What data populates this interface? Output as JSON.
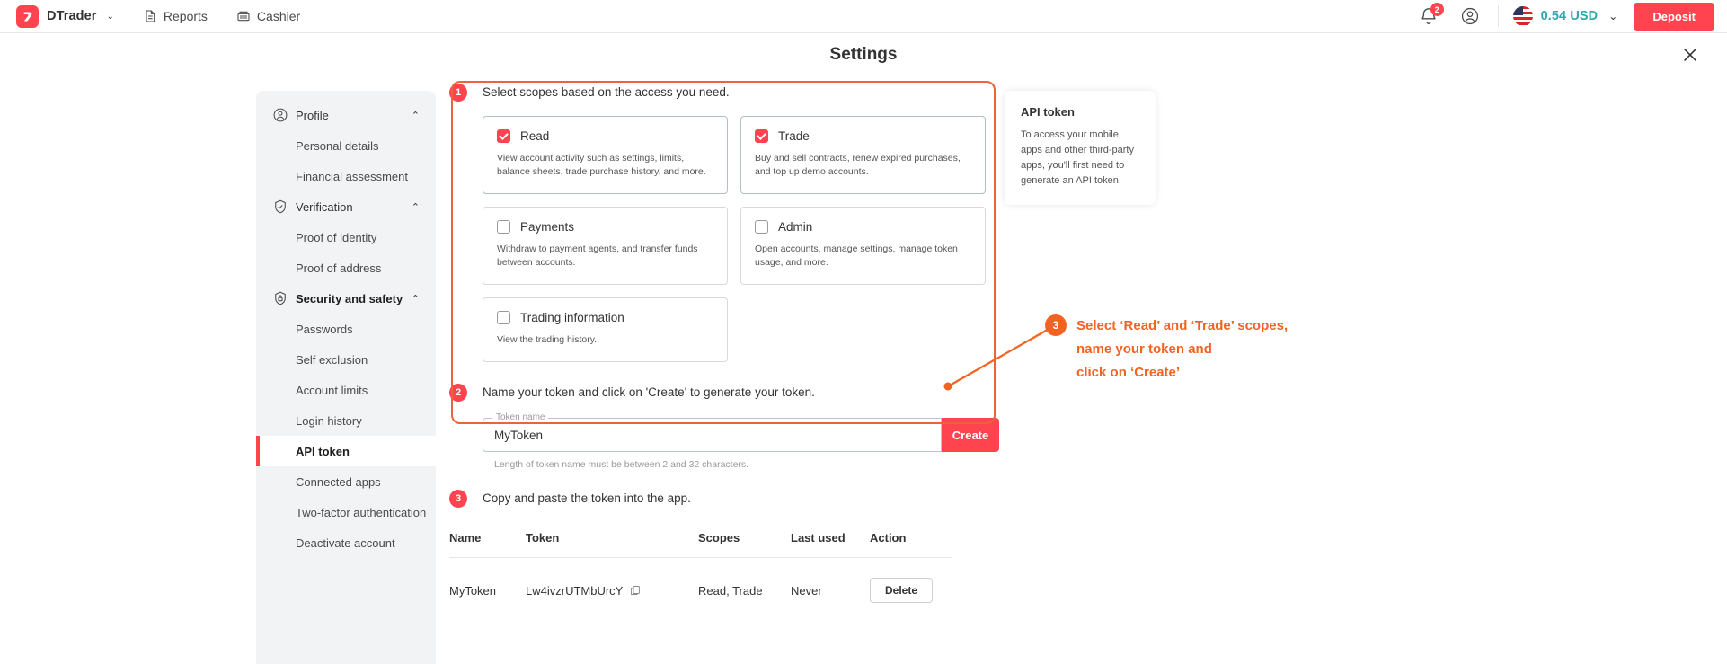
{
  "topbar": {
    "brand": "DTrader",
    "brand_caret": "⌄",
    "nav": [
      {
        "label": "Reports",
        "icon": "reports-icon"
      },
      {
        "label": "Cashier",
        "icon": "cashier-icon"
      }
    ],
    "notification_count": "2",
    "balance": "0.54 USD",
    "balance_caret": "⌄",
    "deposit_label": "Deposit",
    "accent_color": "#ff444f",
    "balance_color": "#2ea8b0"
  },
  "settings": {
    "title": "Settings",
    "close_label": "✕"
  },
  "sidebar": {
    "items": [
      {
        "label": "Profile",
        "type": "group",
        "icon": "person-circle-icon",
        "chevron": "⌃"
      },
      {
        "label": "Personal details",
        "type": "sub"
      },
      {
        "label": "Financial assessment",
        "type": "sub"
      },
      {
        "label": "Verification",
        "type": "group",
        "icon": "shield-check-icon",
        "chevron": "⌃"
      },
      {
        "label": "Proof of identity",
        "type": "sub"
      },
      {
        "label": "Proof of address",
        "type": "sub"
      },
      {
        "label": "Security and safety",
        "type": "group-bold",
        "icon": "shield-lock-icon",
        "chevron": "⌃"
      },
      {
        "label": "Passwords",
        "type": "sub"
      },
      {
        "label": "Self exclusion",
        "type": "sub"
      },
      {
        "label": "Account limits",
        "type": "sub"
      },
      {
        "label": "Login history",
        "type": "sub"
      },
      {
        "label": "API token",
        "type": "sub",
        "active": true
      },
      {
        "label": "Connected apps",
        "type": "sub"
      },
      {
        "label": "Two-factor authentication",
        "type": "sub"
      },
      {
        "label": "Deactivate account",
        "type": "sub"
      }
    ]
  },
  "main": {
    "step1": {
      "number": "1",
      "text": "Select scopes based on the access you need."
    },
    "scopes": [
      {
        "name": "Read",
        "checked": true,
        "description": "View account activity such as settings, limits, balance sheets, trade purchase history, and more."
      },
      {
        "name": "Trade",
        "checked": true,
        "description": "Buy and sell contracts, renew expired purchases, and top up demo accounts."
      },
      {
        "name": "Payments",
        "checked": false,
        "description": "Withdraw to payment agents, and transfer funds between accounts."
      },
      {
        "name": "Admin",
        "checked": false,
        "description": "Open accounts, manage settings, manage token usage, and more."
      },
      {
        "name": "Trading information",
        "checked": false,
        "description": "View the trading history."
      }
    ],
    "step2": {
      "number": "2",
      "text": "Name your token and click on 'Create' to generate your token."
    },
    "token_field": {
      "legend": "Token name",
      "value": "MyToken",
      "placeholder": "Token name"
    },
    "create_label": "Create",
    "helper_text": "Length of token name must be between 2 and 32 characters.",
    "step3": {
      "number": "3",
      "text": "Copy and paste the token into the app."
    },
    "table": {
      "headers": [
        "Name",
        "Token",
        "Scopes",
        "Last used",
        "Action"
      ],
      "rows": [
        {
          "name": "MyToken",
          "token": "Lw4ivzrUTMbUrcY",
          "scopes": "Read, Trade",
          "last_used": "Never",
          "action": "Delete"
        }
      ]
    }
  },
  "info_panel": {
    "title": "API token",
    "body": "To access your mobile apps and other third-party apps, you'll first need to generate an API token."
  },
  "callout": {
    "number": "3",
    "line1": "Select ‘Read’ and ‘Trade’ scopes,",
    "line2": "name your token and",
    "line3": "click on ‘Create’",
    "color": "#f26322"
  }
}
